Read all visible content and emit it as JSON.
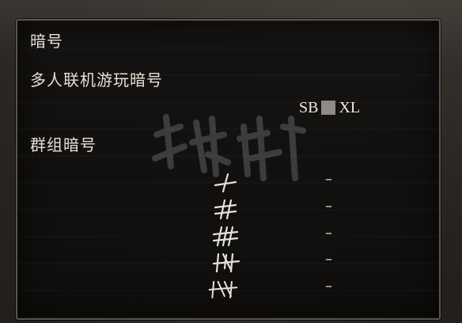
{
  "title": "暗号",
  "multiplayer": {
    "label": "多人联机游玩暗号",
    "password": {
      "prefix": "SB",
      "suffix": "XL"
    }
  },
  "group": {
    "label": "群组暗号",
    "rows": [
      {
        "glyph": "one-strike-glyph",
        "value": "–"
      },
      {
        "glyph": "two-strike-glyph",
        "value": "–"
      },
      {
        "glyph": "three-strike-glyph",
        "value": "–"
      },
      {
        "glyph": "four-strike-glyph",
        "value": "–"
      },
      {
        "glyph": "five-strike-glyph",
        "value": "–"
      }
    ]
  },
  "colors": {
    "panel_border": "#5a544c",
    "text": "#e7e1d6",
    "redaction": "#8e8a84"
  }
}
